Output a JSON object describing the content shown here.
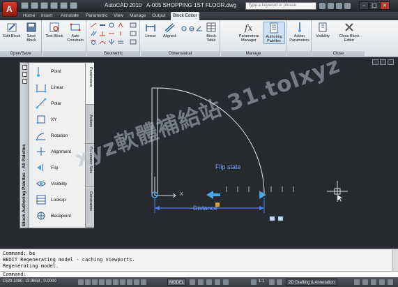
{
  "window": {
    "app_name": "AutoCAD 2010",
    "file_name": "A-005 SHOPPING 1ST FLOOR.dwg",
    "help_placeholder": "Type a keyword or phrase"
  },
  "ribbon_tabs": [
    {
      "label": "Home",
      "active": false
    },
    {
      "label": "Insert",
      "active": false
    },
    {
      "label": "Annotate",
      "active": false
    },
    {
      "label": "Parametric",
      "active": false
    },
    {
      "label": "View",
      "active": false
    },
    {
      "label": "Manage",
      "active": false
    },
    {
      "label": "Output",
      "active": false
    },
    {
      "label": "Block Editor",
      "active": true
    }
  ],
  "ribbon_groups": [
    {
      "label": "Open/Save",
      "buttons": [
        {
          "label": "Edit Block",
          "icon": "edit-block-icon"
        },
        {
          "label": "Save Block",
          "icon": "save-block-icon"
        }
      ]
    },
    {
      "label": "",
      "buttons": [
        {
          "label": "Test Block",
          "icon": "test-block-icon"
        },
        {
          "label": "Auto Constrain",
          "icon": "auto-constrain-icon"
        }
      ]
    },
    {
      "label": "Geometric",
      "buttons": []
    },
    {
      "label": "Dimensional",
      "buttons": [
        {
          "label": "Linear",
          "icon": "linear-dim-icon"
        },
        {
          "label": "Aligned",
          "icon": "aligned-dim-icon"
        },
        {
          "label": "Block Table",
          "icon": "block-table-icon"
        }
      ]
    },
    {
      "label": "Manage",
      "buttons": [
        {
          "label": "Parameters Manager",
          "icon": "parameters-manager-icon"
        },
        {
          "label": "Authoring Palettes",
          "icon": "authoring-palettes-icon"
        }
      ]
    },
    {
      "label": "",
      "buttons": [
        {
          "label": "Action Parameters",
          "icon": "action-parameters-icon"
        }
      ]
    },
    {
      "label": "Close",
      "buttons": [
        {
          "label": "Visibility",
          "icon": "visibility-icon"
        },
        {
          "label": "Close Block Editor",
          "icon": "close-block-editor-icon"
        }
      ]
    }
  ],
  "palette": {
    "title": "Block Authoring Palettes - All Palettes",
    "tools": [
      {
        "label": "Point"
      },
      {
        "label": "Linear"
      },
      {
        "label": "Polar"
      },
      {
        "label": "XY"
      },
      {
        "label": "Rotation"
      },
      {
        "label": "Alignment"
      },
      {
        "label": "Flip"
      },
      {
        "label": "Visibility"
      },
      {
        "label": "Lookup"
      },
      {
        "label": "Basepoint"
      }
    ],
    "tabs": [
      {
        "label": "Parameters",
        "active": true
      },
      {
        "label": "Actions",
        "active": false
      },
      {
        "label": "Parameter Sets",
        "active": false
      },
      {
        "label": "Constraints",
        "active": false
      }
    ]
  },
  "drawing": {
    "flip_state_label": "Flip state",
    "distance_label": "Distance",
    "x_axis_label": "X"
  },
  "command": {
    "lines": [
      "Command: be",
      "BEDIT Regenerating model - caching viewports.",
      "Regenerating model."
    ],
    "prompt": "Command:"
  },
  "status": {
    "coords": "1529.1080, 13.9659 , 0.0000",
    "model_label": "MODEL",
    "scale": "1:1",
    "workspace": "2D Drafting & Annotation"
  },
  "watermark": "xyz軟體補給站 31.tolxyz",
  "colors": {
    "canvas_bg": "#262a2e",
    "param_blue": "#7aa0ff",
    "grip_cyan": "#4aa8e8"
  }
}
